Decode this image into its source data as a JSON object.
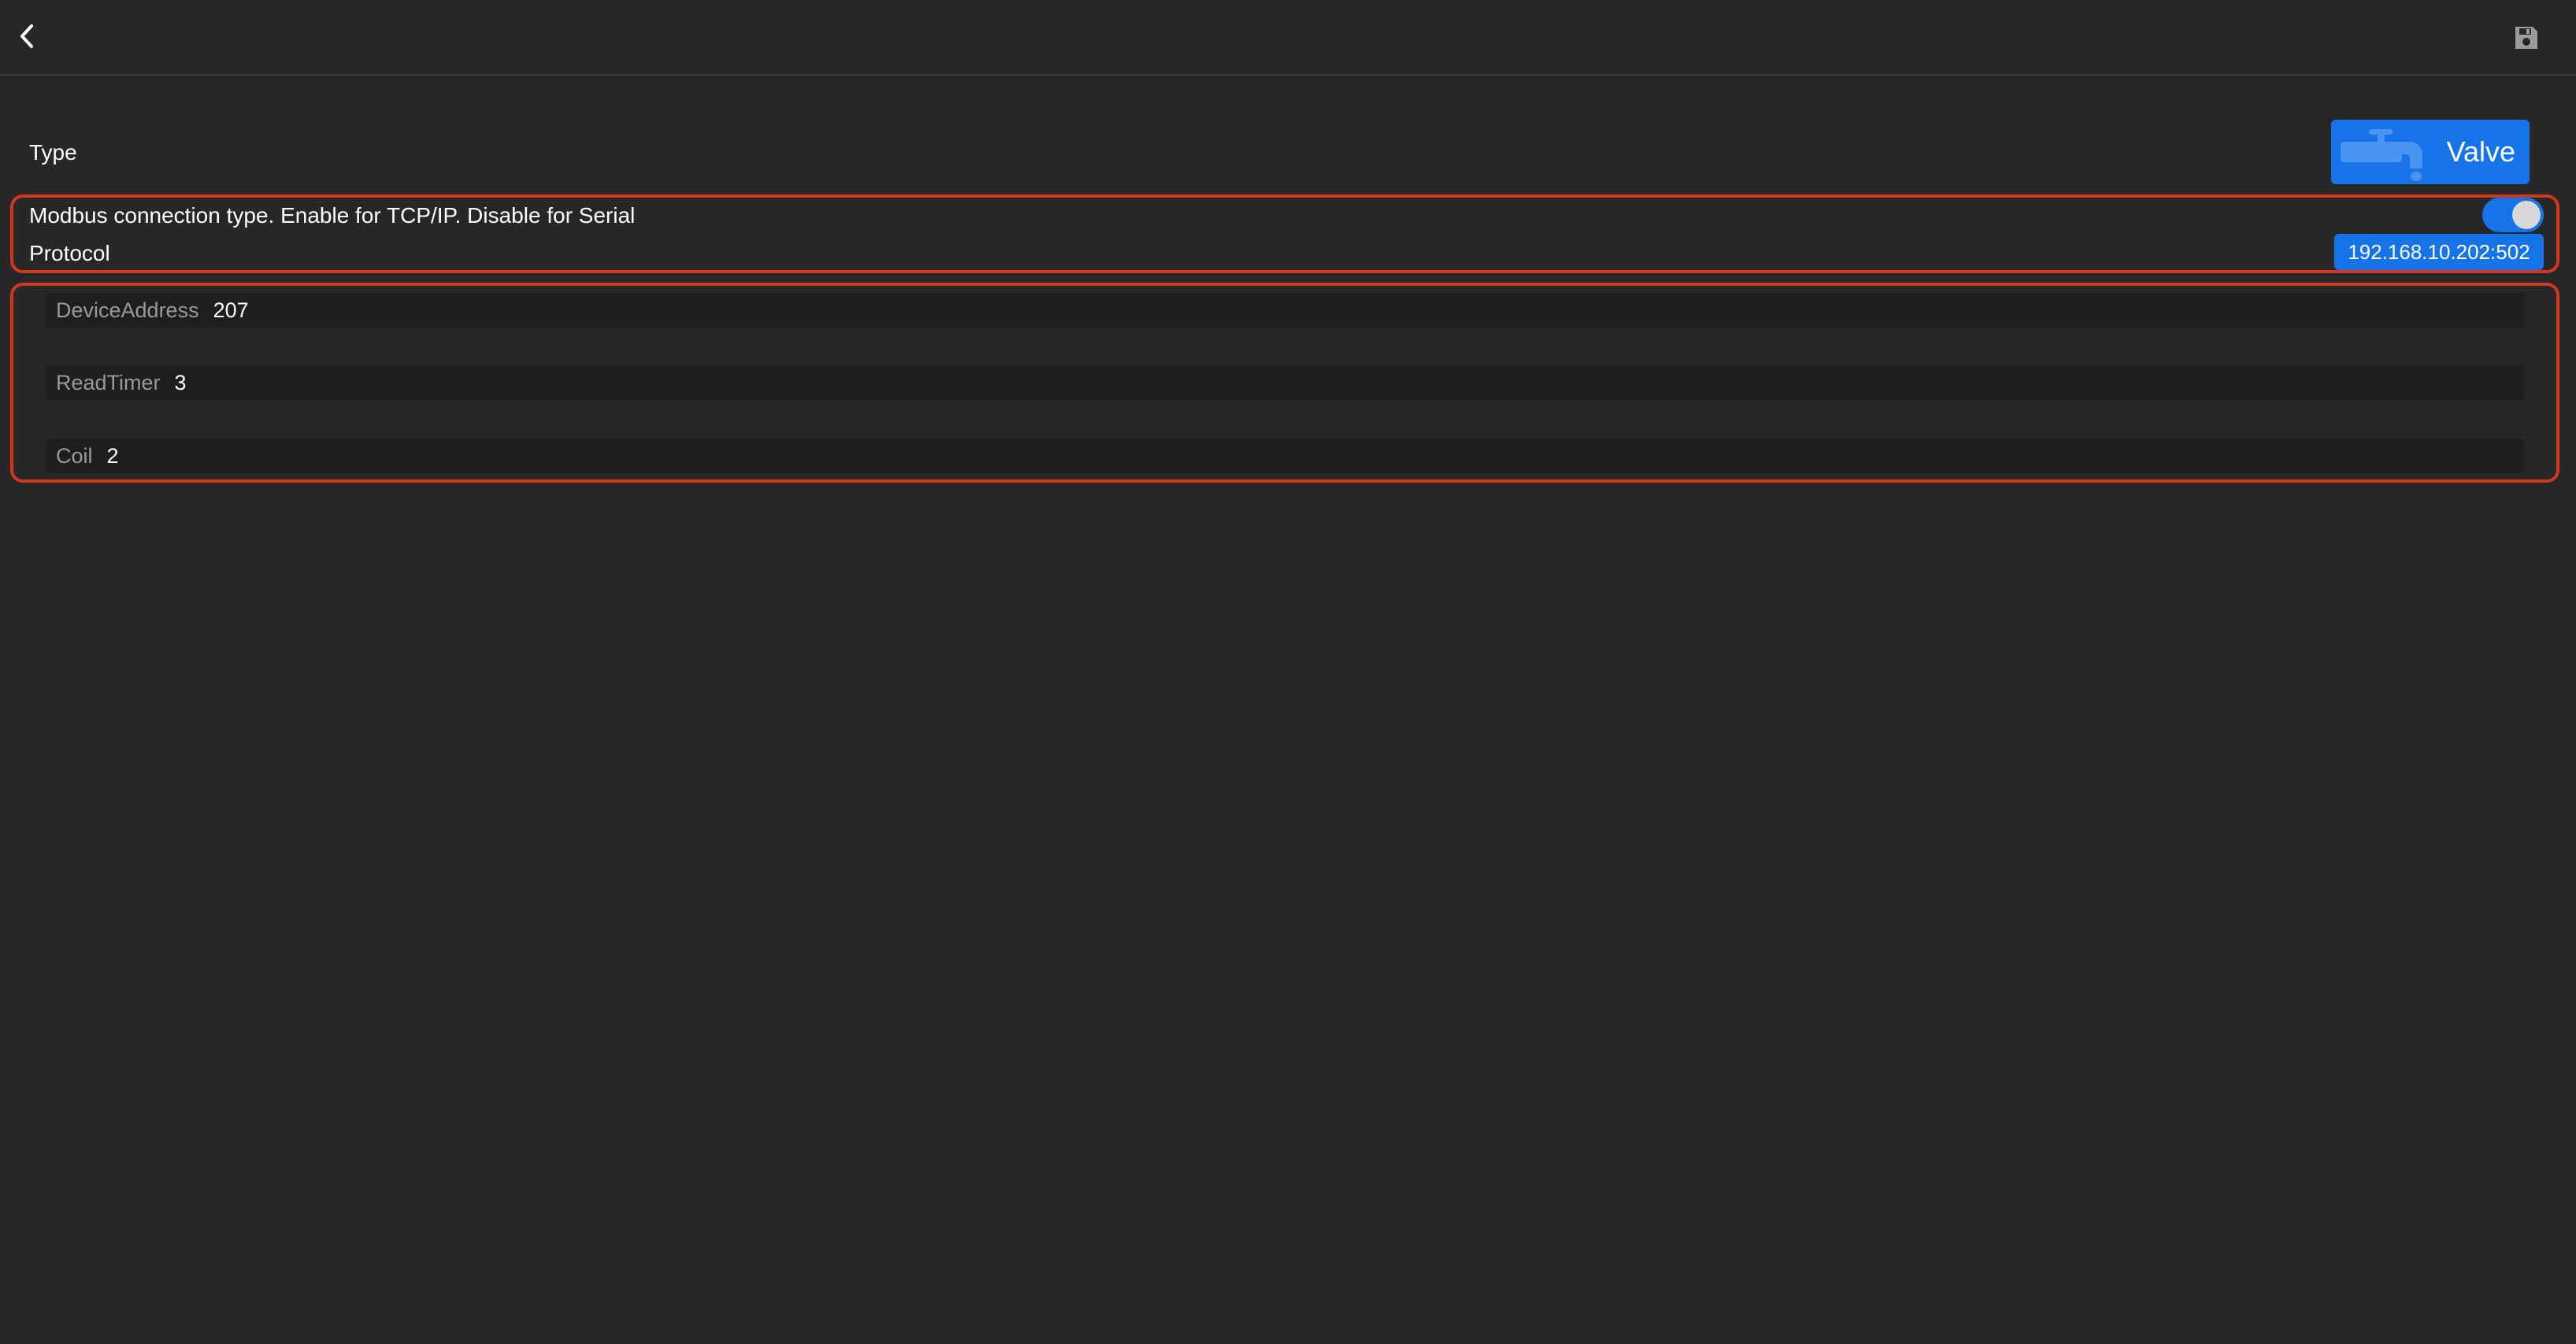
{
  "header": {
    "back_icon": "chevron-left-icon",
    "save_icon": "floppy-disk-icon"
  },
  "type_row": {
    "label": "Type",
    "value": "Valve",
    "icon": "faucet-icon"
  },
  "connection": {
    "modbus_label": "Modbus connection type. Enable for TCP/IP. Disable for Serial",
    "protocol_label": "Protocol",
    "protocol_value": "192.168.10.202:502",
    "tcp_enabled": true
  },
  "fields": [
    {
      "label": "DeviceAddress",
      "value": "207"
    },
    {
      "label": "ReadTimer",
      "value": "3"
    },
    {
      "label": "Coil",
      "value": "2"
    }
  ],
  "colors": {
    "background": "#272727",
    "accent": "#1773e8",
    "highlight": "#d3361f",
    "field_bg": "#1e1e1e"
  }
}
